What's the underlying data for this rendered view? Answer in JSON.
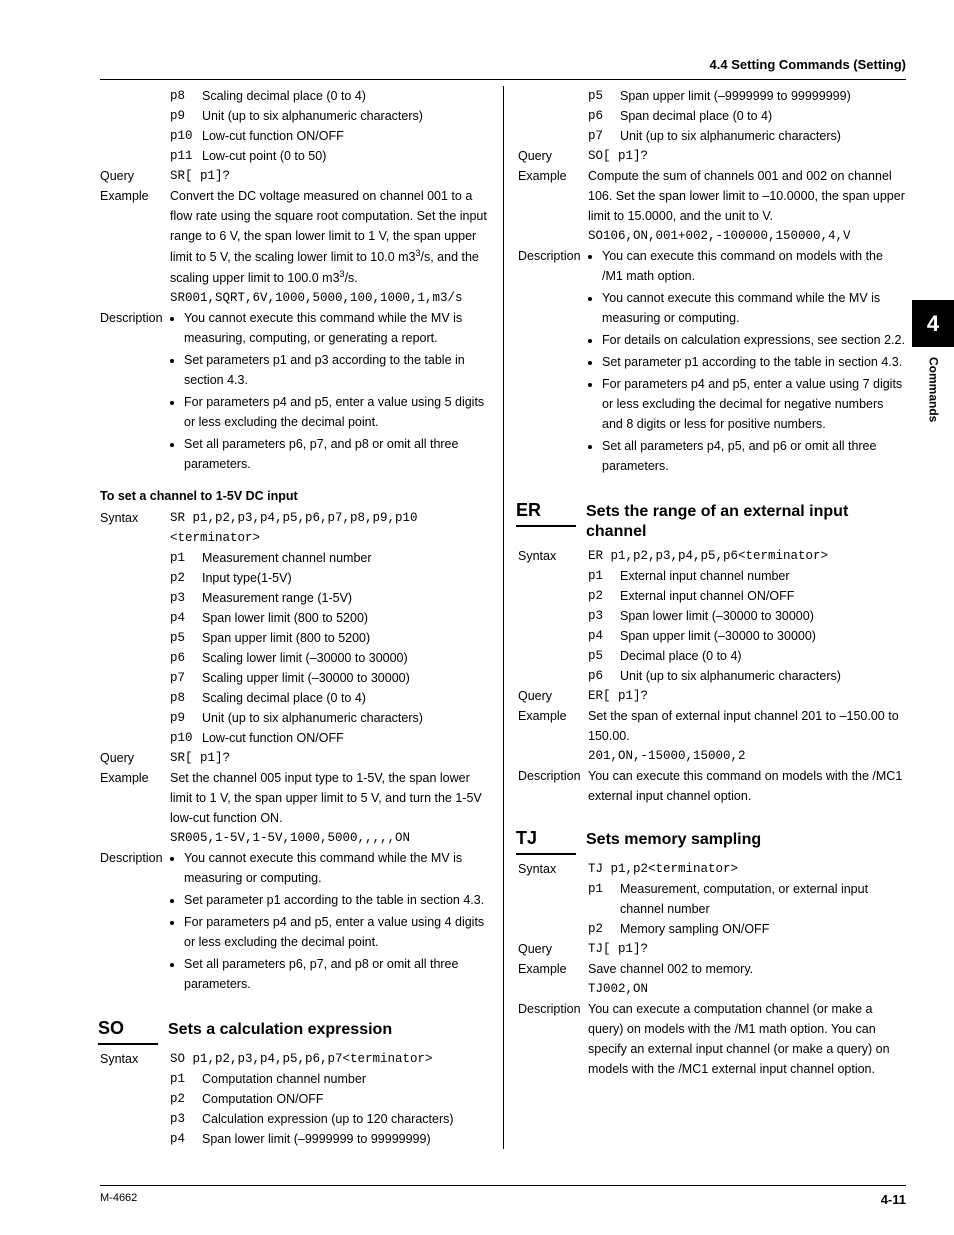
{
  "header": {
    "section": "4.4  Setting Commands (Setting)"
  },
  "side": {
    "chapter": "4",
    "label": "Commands"
  },
  "footer": {
    "left": "M-4662",
    "right": "4-11"
  },
  "sr_top_params": [
    {
      "n": "p8",
      "d": "Scaling decimal place (0 to 4)"
    },
    {
      "n": "p9",
      "d": "Unit (up to six alphanumeric characters)"
    },
    {
      "n": "p10",
      "d": "Low-cut function ON/OFF"
    },
    {
      "n": "p11",
      "d": "Low-cut point (0 to 50)"
    }
  ],
  "sr_top_query_lab": "Query",
  "sr_top_query": "SR[ p1]?",
  "sr_top_example_lab": "Example",
  "sr_top_example_text": "Convert the DC voltage measured on channel 001 to a flow rate using the square root computation. Set the input range to 6 V, the span lower limit to 1 V, the span upper limit to 5 V, the scaling lower limit to 10.0 m",
  "sr_top_example_text2": "/s, and the scaling upper limit to 100.0 m",
  "sr_top_example_text3": "/s.",
  "sr_top_example_code": "SR001,SQRT,6V,1000,5000,100,1000,1,m3/s",
  "sr_top_desc_lab": "Description",
  "sr_top_desc": [
    "You cannot execute this command while the MV is measuring, computing, or generating a report.",
    "Set parameters p1 and p3 according to the table in section 4.3.",
    "For parameters p4 and p5, enter a value using 5 digits or less excluding the decimal point.",
    "Set all parameters p6, p7, and p8 or omit all three parameters."
  ],
  "sr_1_5v_head": "To set a channel to 1-5V DC input",
  "sr_1_5v_syntax_lab": "Syntax",
  "sr_1_5v_syntax": "SR p1,p2,p3,p4,p5,p6,p7,p8,p9,p10 <terminator>",
  "sr_1_5v_params": [
    {
      "n": "p1",
      "d": "Measurement channel number"
    },
    {
      "n": "p2",
      "d": "Input type(1-5V)"
    },
    {
      "n": "p3",
      "d": "Measurement range (1-5V)"
    },
    {
      "n": "p4",
      "d": "Span lower limit (800 to 5200)"
    },
    {
      "n": "p5",
      "d": "Span upper limit (800 to 5200)"
    },
    {
      "n": "p6",
      "d": "Scaling lower limit (–30000 to 30000)"
    },
    {
      "n": "p7",
      "d": "Scaling upper limit (–30000 to 30000)"
    },
    {
      "n": "p8",
      "d": "Scaling decimal place (0 to 4)"
    },
    {
      "n": "p9",
      "d": "Unit (up to six alphanumeric characters)"
    },
    {
      "n": "p10",
      "d": "Low-cut function ON/OFF"
    }
  ],
  "sr_1_5v_query_lab": "Query",
  "sr_1_5v_query": "SR[ p1]?",
  "sr_1_5v_example_lab": "Example",
  "sr_1_5v_example_text": "Set the channel 005 input type to 1-5V, the span lower limit to 1 V, the span upper limit to 5 V, and turn the 1-5V low-cut function ON.",
  "sr_1_5v_example_code": "SR005,1-5V,1-5V,1000,5000,,,,,ON",
  "sr_1_5v_desc_lab": "Description",
  "sr_1_5v_desc": [
    "You cannot execute this command while the MV is measuring or computing.",
    "Set parameter p1 according to the table in section 4.3.",
    "For parameters p4 and p5, enter a value using 4 digits or less excluding the decimal point.",
    "Set all parameters p6, p7, and p8 or omit all three parameters."
  ],
  "so_cmd": "SO",
  "so_title": "Sets a calculation expression",
  "so_syntax_lab": "Syntax",
  "so_syntax": "SO p1,p2,p3,p4,p5,p6,p7<terminator>",
  "so_params_a": [
    {
      "n": "p1",
      "d": "Computation channel number"
    },
    {
      "n": "p2",
      "d": "Computation ON/OFF"
    },
    {
      "n": "p3",
      "d": "Calculation expression (up to 120 characters)"
    },
    {
      "n": "p4",
      "d": "Span lower limit (–9999999 to 99999999)"
    }
  ],
  "so_params_b": [
    {
      "n": "p5",
      "d": "Span upper limit (–9999999 to 99999999)"
    },
    {
      "n": "p6",
      "d": "Span decimal place (0 to 4)"
    },
    {
      "n": "p7",
      "d": "Unit (up to six alphanumeric characters)"
    }
  ],
  "so_query_lab": "Query",
  "so_query": "SO[ p1]?",
  "so_example_lab": "Example",
  "so_example_text": "Compute the sum of channels 001 and 002 on channel 106. Set the span lower limit to –10.0000, the span upper limit to 15.0000, and the unit to V.",
  "so_example_code": "SO106,ON,001+002,-100000,150000,4,V",
  "so_desc_lab": "Description",
  "so_desc": [
    "You can execute this command on models with the /M1 math option.",
    "You cannot execute this command while the MV is measuring or computing.",
    "For details on calculation expressions, see section 2.2.",
    "Set parameter p1 according to the table in section 4.3.",
    "For parameters p4 and p5, enter a value using 7 digits or less excluding the decimal for negative numbers and 8 digits or less for positive numbers.",
    "Set all parameters p4, p5, and p6 or omit all three parameters."
  ],
  "er_cmd": "ER",
  "er_title": "Sets the range of an external input channel",
  "er_syntax_lab": "Syntax",
  "er_syntax": "ER p1,p2,p3,p4,p5,p6<terminator>",
  "er_params": [
    {
      "n": "p1",
      "d": "External input channel number"
    },
    {
      "n": "p2",
      "d": "External input channel ON/OFF"
    },
    {
      "n": "p3",
      "d": "Span lower limit (–30000 to 30000)"
    },
    {
      "n": "p4",
      "d": "Span upper limit (–30000 to 30000)"
    },
    {
      "n": "p5",
      "d": "Decimal place (0 to 4)"
    },
    {
      "n": "p6",
      "d": "Unit (up to six alphanumeric characters)"
    }
  ],
  "er_query_lab": "Query",
  "er_query": "ER[ p1]?",
  "er_example_lab": "Example",
  "er_example_text": "Set the span of external input channel 201 to –150.00 to 150.00.",
  "er_example_code": "201,ON,-15000,15000,2",
  "er_desc_lab": "Description",
  "er_desc_text": "You can execute this command on models with the /MC1 external input channel option.",
  "tj_cmd": "TJ",
  "tj_title": "Sets memory sampling",
  "tj_syntax_lab": "Syntax",
  "tj_syntax": "TJ p1,p2<terminator>",
  "tj_params": [
    {
      "n": "p1",
      "d": "Measurement, computation, or external input channel number"
    },
    {
      "n": "p2",
      "d": "Memory sampling ON/OFF"
    }
  ],
  "tj_query_lab": "Query",
  "tj_query": "TJ[ p1]?",
  "tj_example_lab": "Example",
  "tj_example_text": "Save channel 002 to memory.",
  "tj_example_code": "TJ002,ON",
  "tj_desc_lab": "Description",
  "tj_desc_text": "You can execute a computation channel (or make a query) on models with the /M1 math option. You can specify an external input channel (or make a query) on models with the /MC1 external input channel option."
}
